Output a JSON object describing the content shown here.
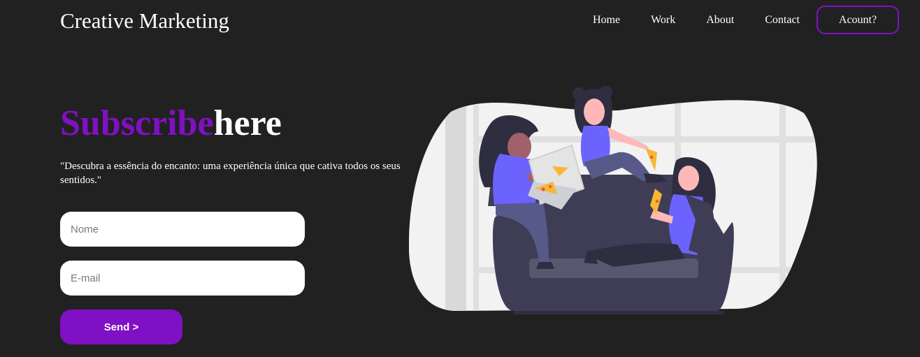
{
  "header": {
    "brand": "Creative Marketing",
    "nav": [
      {
        "label": "Home"
      },
      {
        "label": "Work"
      },
      {
        "label": "About"
      },
      {
        "label": "Contact"
      }
    ],
    "account_label": "Acount?"
  },
  "hero": {
    "title_accent": "Subscribe",
    "title_rest": "here",
    "tagline": "\"Descubra a essência do encanto: uma experiência única que cativa todos os seus sentidos.\""
  },
  "form": {
    "name_placeholder": "Nome",
    "email_placeholder": "E-mail",
    "send_label": "Send >"
  },
  "colors": {
    "background": "#212121",
    "accent": "#8010c4",
    "blob": "#f2f2f2",
    "sofa": "#3f3d56",
    "figure_shirt": "#6c63ff"
  }
}
